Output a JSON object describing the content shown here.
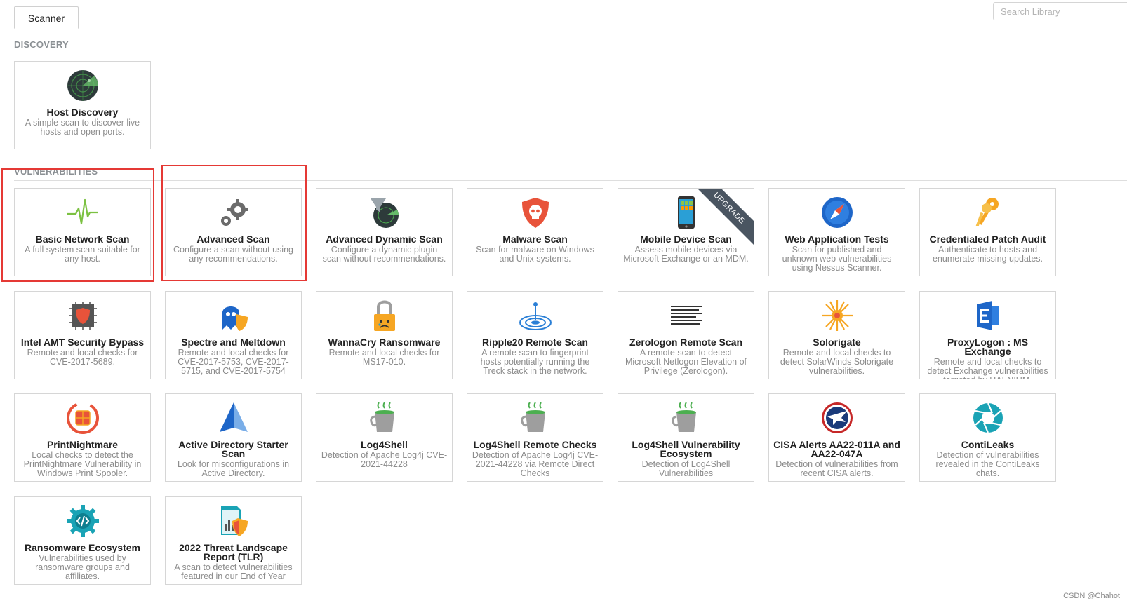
{
  "tabs": {
    "scanner": "Scanner"
  },
  "search": {
    "placeholder": "Search Library"
  },
  "sections": {
    "discovery": "DISCOVERY",
    "vulnerabilities": "VULNERABILITIES"
  },
  "ribbon": {
    "upgrade": "UPGRADE"
  },
  "watermark": "CSDN @Chahot",
  "colors": {
    "highlight": "#e53935",
    "card_border": "#d6d6d6",
    "section_text": "#8a8f93"
  },
  "discovery_cards": [
    {
      "icon": "radar-icon",
      "title": "Host Discovery",
      "desc": "A simple scan to discover live hosts and open ports."
    }
  ],
  "vuln_cards": [
    {
      "icon": "pulse-icon",
      "title": "Basic Network Scan",
      "desc": "A full system scan suitable for any host."
    },
    {
      "icon": "gears-icon",
      "title": "Advanced Scan",
      "desc": "Configure a scan without using any recommendations."
    },
    {
      "icon": "funnel-radar-icon",
      "title": "Advanced Dynamic Scan",
      "desc": "Configure a dynamic plugin scan without recommendations."
    },
    {
      "icon": "skull-shield-icon",
      "title": "Malware Scan",
      "desc": "Scan for malware on Windows and Unix systems."
    },
    {
      "icon": "mobile-phone-icon",
      "title": "Mobile Device Scan",
      "desc": "Assess mobile devices via Microsoft Exchange or an MDM."
    },
    {
      "icon": "compass-icon",
      "title": "Web Application Tests",
      "desc": "Scan for published and unknown web vulnerabilities using Nessus Scanner."
    },
    {
      "icon": "keys-icon",
      "title": "Credentialed Patch Audit",
      "desc": "Authenticate to hosts and enumerate missing updates."
    },
    {
      "icon": "chip-shield-icon",
      "title": "Intel AMT Security Bypass",
      "desc": "Remote and local checks for CVE-2017-5689."
    },
    {
      "icon": "ghost-icon",
      "title": "Spectre and Meltdown",
      "desc": "Remote and local checks for CVE-2017-5753, CVE-2017-5715, and CVE-2017-5754"
    },
    {
      "icon": "padlock-icon",
      "title": "WannaCry Ransomware",
      "desc": "Remote and local checks for MS17-010."
    },
    {
      "icon": "ripple-icon",
      "title": "Ripple20 Remote Scan",
      "desc": "A remote scan to fingerprint hosts potentially running the Treck stack in the network."
    },
    {
      "icon": "binary-text-icon",
      "title": "Zerologon Remote Scan",
      "desc": "A remote scan to detect Microsoft Netlogon Elevation of Privilege (Zerologon)."
    },
    {
      "icon": "sunburst-icon",
      "title": "Solorigate",
      "desc": "Remote and local checks to detect SolarWinds Solorigate vulnerabilities."
    },
    {
      "icon": "exchange-logo-icon",
      "title": "ProxyLogon : MS Exchange",
      "desc": "Remote and local checks to detect Exchange vulnerabilities targeted by HAFNIUM."
    },
    {
      "icon": "printnightmare-icon",
      "title": "PrintNightmare",
      "desc": "Local checks to detect the PrintNightmare Vulnerability in Windows Print Spooler."
    },
    {
      "icon": "pyramid-icon",
      "title": "Active Directory Starter Scan",
      "desc": "Look for misconfigurations in Active Directory."
    },
    {
      "icon": "coffee-cup-icon",
      "title": "Log4Shell",
      "desc": "Detection of Apache Log4j CVE-2021-44228"
    },
    {
      "icon": "coffee-cup-icon",
      "title": "Log4Shell Remote Checks",
      "desc": "Detection of Apache Log4j CVE-2021-44228 via Remote Direct Checks"
    },
    {
      "icon": "coffee-cup-icon",
      "title": "Log4Shell Vulnerability Ecosystem",
      "desc": "Detection of Log4Shell Vulnerabilities"
    },
    {
      "icon": "eagle-seal-icon",
      "title": "CISA Alerts AA22-011A and AA22-047A",
      "desc": "Detection of vulnerabilities from recent CISA alerts."
    },
    {
      "icon": "aperture-icon",
      "title": "ContiLeaks",
      "desc": "Detection of vulnerabilities revealed in the ContiLeaks chats."
    },
    {
      "icon": "gear-code-icon",
      "title": "Ransomware Ecosystem",
      "desc": "Vulnerabilities used by ransomware groups and affiliates."
    },
    {
      "icon": "report-shield-icon",
      "title": "2022 Threat Landscape Report (TLR)",
      "desc": "A scan to detect vulnerabilities featured in our End of Year"
    }
  ]
}
